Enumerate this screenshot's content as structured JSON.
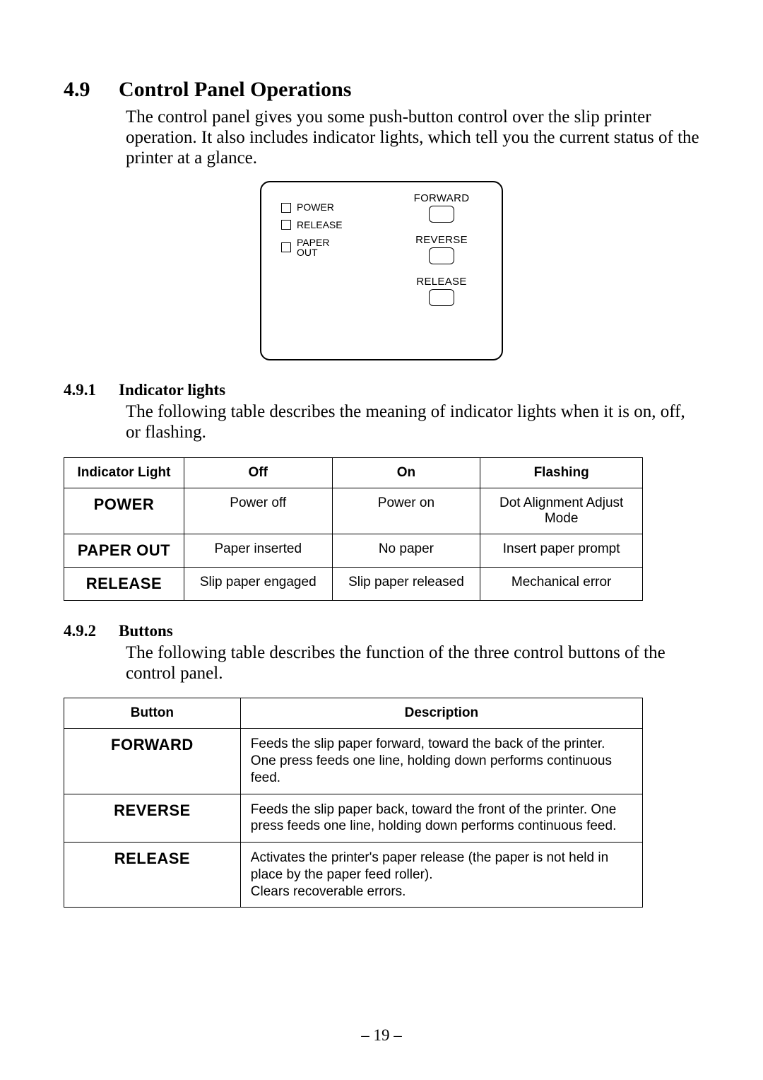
{
  "section": {
    "num": "4.9",
    "title": "Control Panel Operations"
  },
  "intro": "The control panel gives you some push-button control over the slip printer operation. It also includes indicator lights, which tell you the current status of the printer at a glance.",
  "panel": {
    "indicators": [
      "POWER",
      "RELEASE",
      "PAPER\nOUT"
    ],
    "buttons": [
      "FORWARD",
      "REVERSE",
      "RELEASE"
    ]
  },
  "sub1": {
    "num": "4.9.1",
    "title": "Indicator lights",
    "text": "The following table describes the meaning of indicator lights when it is on, off, or flashing.",
    "headers": [
      "Indicator Light",
      "Off",
      "On",
      "Flashing"
    ],
    "rows": [
      {
        "name": "POWER",
        "off": "Power off",
        "on": "Power on",
        "flash": "Dot Alignment Adjust Mode"
      },
      {
        "name": "PAPER OUT",
        "off": "Paper inserted",
        "on": "No paper",
        "flash": "Insert paper prompt"
      },
      {
        "name": "RELEASE",
        "off": "Slip paper engaged",
        "on": "Slip paper released",
        "flash": "Mechanical error"
      }
    ]
  },
  "sub2": {
    "num": "4.9.2",
    "title": "Buttons",
    "text": "The following table describes the function of the three control buttons of the control panel.",
    "headers": [
      "Button",
      "Description"
    ],
    "rows": [
      {
        "name": "FORWARD",
        "desc": "Feeds the slip paper forward, toward the back of the printer. One press feeds one line, holding down performs continuous feed."
      },
      {
        "name": "REVERSE",
        "desc": "Feeds the slip paper back, toward the front of the printer. One press feeds one line, holding down performs continuous feed."
      },
      {
        "name": "RELEASE",
        "desc": "Activates the printer's paper release (the paper is not held in place by the paper feed roller).\nClears recoverable errors."
      }
    ]
  },
  "page_number": "– 19 –"
}
